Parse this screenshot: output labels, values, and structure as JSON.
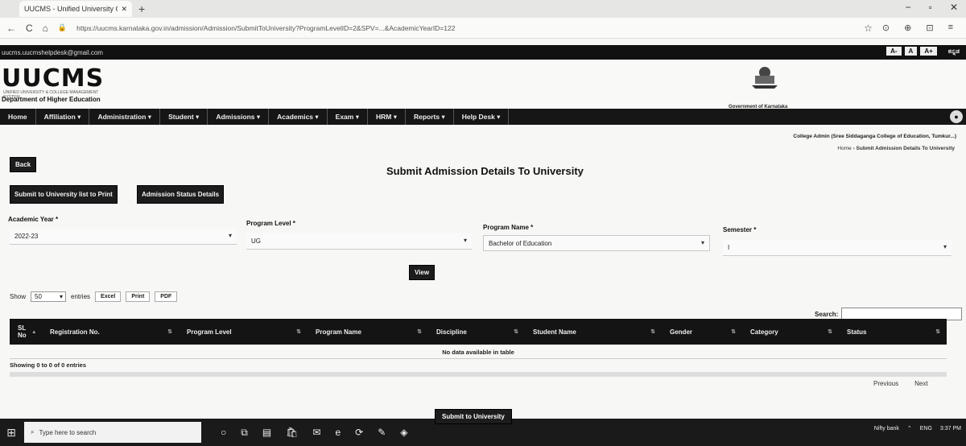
{
  "browser": {
    "tab_title": "UUCMS - Unified University C...",
    "url": "https://uucms.karnataka.gov.in/admission/Admission/SubmitToUniversity?ProgramLevelID=2&SPV=...&AcademicYearID=122",
    "close": "✕",
    "plus": "+",
    "back": "←",
    "reload": "C",
    "home": "⌂",
    "lock": "🔒",
    "minimize": "−",
    "maximize": "▫",
    "close_win": "✕",
    "star": "☆",
    "right_icons": [
      "⊙",
      "⊕",
      "⊡",
      "≡"
    ]
  },
  "site": {
    "email": "uucms.uucmshelpdesk@gmail.com",
    "font_buttons": [
      "A-",
      "A",
      "A+"
    ],
    "lang": "ಕನ್ನಡ",
    "logo": "UUCMS",
    "logo_sub": "UNIFIED UNIVERSITY & COLLEGE MANAGEMENT SYSTEM",
    "dept": "Department of Higher Education",
    "gov": "Government of Karnataka"
  },
  "nav": [
    {
      "label": "Home"
    },
    {
      "label": "Affiliation ▾"
    },
    {
      "label": "Administration ▾"
    },
    {
      "label": "Student ▾"
    },
    {
      "label": "Admissions ▾"
    },
    {
      "label": "Academics ▾"
    },
    {
      "label": "Exam ▾"
    },
    {
      "label": "HRM ▾"
    },
    {
      "label": "Reports ▾"
    },
    {
      "label": "Help Desk ▾"
    }
  ],
  "college": "College Admin (Sree Siddaganga College of Education, Tumkur...)",
  "breadcrumb": {
    "home": "Home",
    "sep": " › ",
    "current": "Submit Admission Details To University"
  },
  "page": {
    "back": "Back",
    "title": "Submit Admission Details To University",
    "btn_print": "Submit to University list to Print",
    "btn_status": "Admission Status Details",
    "view": "View",
    "submit": "Submit to University"
  },
  "filters": {
    "academic_year": {
      "label": "Academic Year *",
      "value": "2022-23"
    },
    "program_level": {
      "label": "Program Level *",
      "value": "UG"
    },
    "program_name": {
      "label": "Program Name *",
      "value": "Bachelor of Education"
    },
    "semester": {
      "label": "Semester *",
      "value": "I"
    }
  },
  "table": {
    "show": "Show",
    "entries_value": "50",
    "entries": "entries",
    "export_buttons": [
      "Excel",
      "Print",
      "PDF"
    ],
    "search_label": "Search:",
    "columns": [
      "SL No",
      "Registration No.",
      "Program Level",
      "Program Name",
      "Discipline",
      "Student Name",
      "Gender",
      "Category",
      "Status"
    ],
    "empty": "No data available in table",
    "showing": "Showing 0 to 0 of 0 entries",
    "previous": "Previous",
    "next": "Next"
  },
  "taskbar": {
    "search": "Type here to search",
    "icons": [
      "○",
      "⧉",
      "▤",
      "🛍",
      "✉",
      "e",
      "⟳",
      "✎",
      "◈"
    ],
    "tray": [
      "Nifty bank",
      "⌃",
      "ENG",
      "3:37 PM"
    ]
  }
}
